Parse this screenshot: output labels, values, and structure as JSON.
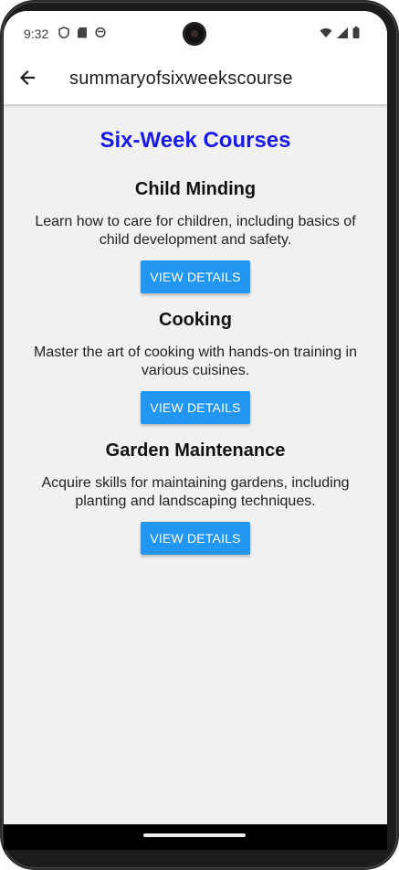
{
  "status_bar": {
    "time": "9:32",
    "left_icons": [
      "shield-icon",
      "sd-card-icon",
      "sync-icon"
    ],
    "right_icons": [
      "wifi-icon",
      "cell-signal-icon",
      "battery-icon"
    ]
  },
  "app_bar": {
    "back_icon": "arrow-left-icon",
    "title": "summaryofsixweekscourse"
  },
  "page": {
    "title": "Six-Week Courses",
    "title_color": "#1a1ae6"
  },
  "courses": [
    {
      "title": "Child Minding",
      "description": "Learn how to care for children, including basics of child development and safety.",
      "button_label": "VIEW DETAILS"
    },
    {
      "title": "Cooking",
      "description": "Master the art of cooking with hands-on training in various cuisines.",
      "button_label": "VIEW DETAILS"
    },
    {
      "title": "Garden Maintenance",
      "description": "Acquire skills for maintaining gardens, including planting and landscaping techniques.",
      "button_label": "VIEW DETAILS"
    }
  ],
  "colors": {
    "button": "#2196f3",
    "background": "#f1f1f1"
  }
}
